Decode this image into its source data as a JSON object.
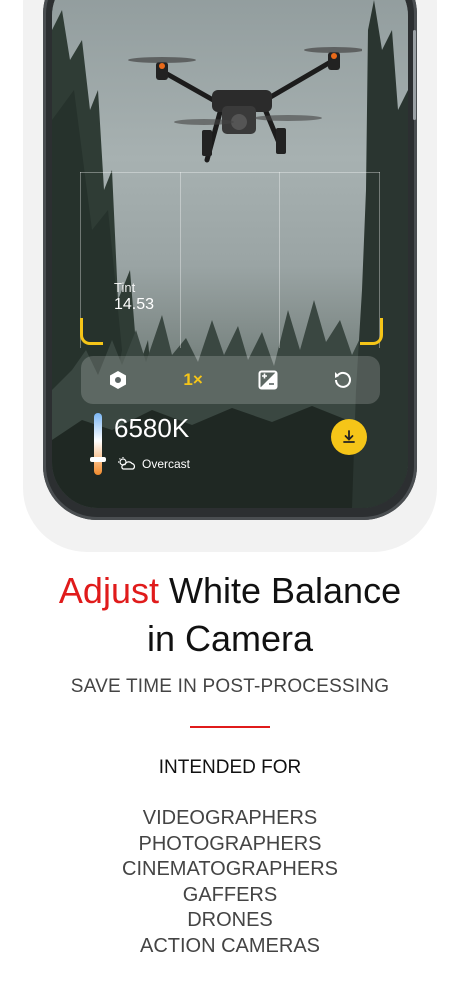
{
  "camera": {
    "tint_label": "Tint",
    "tint_value": "14.53",
    "zoom_label": "1×",
    "temperature": "6580K",
    "weather_label": "Overcast"
  },
  "headline": {
    "accent": "Adjust",
    "rest_line1": " White Balance",
    "line2": "in Camera"
  },
  "subheadline": "SAVE TIME IN POST-PROCESSING",
  "intended_for_heading": "INTENDED FOR",
  "audience": [
    "VIDEOGRAPHERS",
    "PHOTOGRAPHERS",
    "CINEMATOGRAPHERS",
    "GAFFERS",
    "DRONES",
    "ACTION CAMERAS"
  ],
  "colors": {
    "accent_red": "#e01b1b",
    "camera_yellow": "#f5c518"
  }
}
